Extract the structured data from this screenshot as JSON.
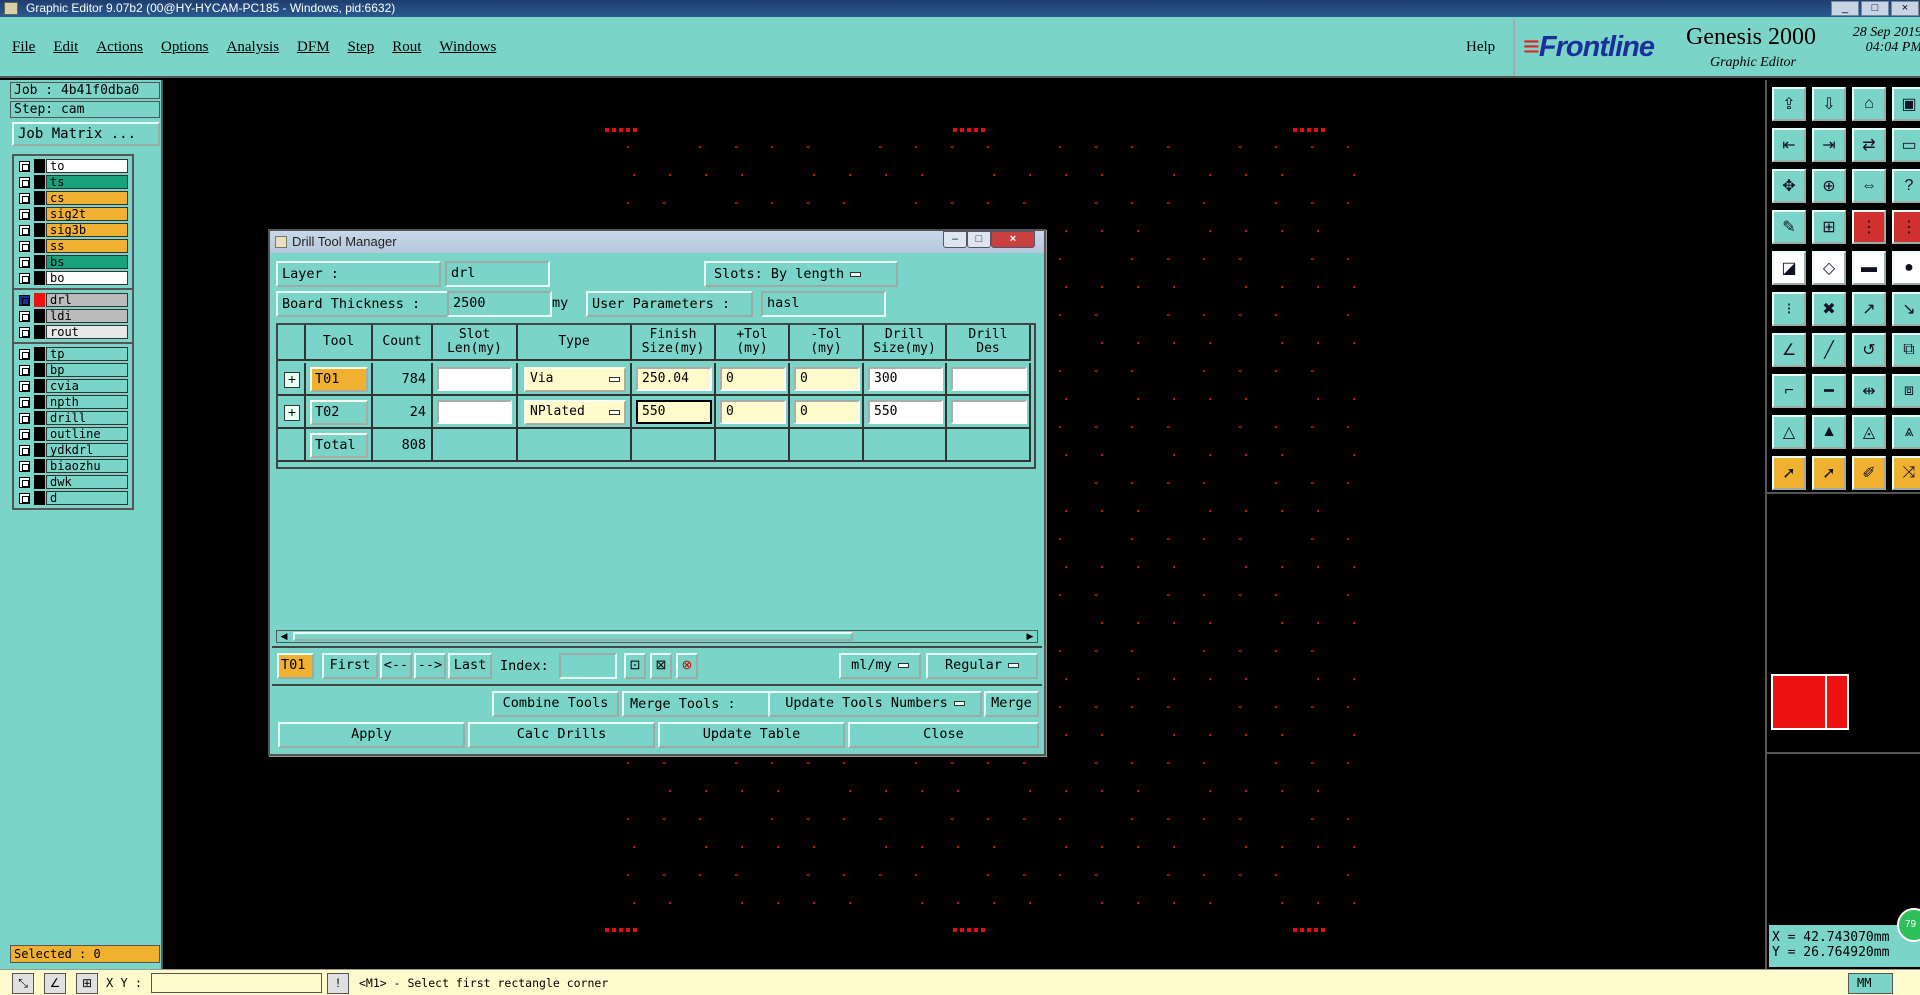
{
  "window": {
    "title": "Graphic Editor 9.07b2 (00@HY-HYCAM-PC185 - Windows, pid:6632)"
  },
  "menu": {
    "items": [
      "File",
      "Edit",
      "Actions",
      "Options",
      "Analysis",
      "DFM",
      "Step",
      "Rout",
      "Windows"
    ],
    "help": "Help"
  },
  "brand": {
    "logo": "Frontline",
    "product": "Genesis 2000",
    "subtitle": "Graphic Editor",
    "date": "28 Sep 2019",
    "time": "04:04 PM"
  },
  "left": {
    "job": "Job : 4b41f0dba0",
    "step": "Step: cam",
    "job_matrix": "Job Matrix ...",
    "board_layers": [
      {
        "name": "to",
        "color": "#ffffff"
      },
      {
        "name": "ts",
        "color": "#1aa07a"
      },
      {
        "name": "cs",
        "color": "#f0b030"
      },
      {
        "name": "sig2t",
        "color": "#f0b030"
      },
      {
        "name": "sig3b",
        "color": "#f0b030"
      },
      {
        "name": "ss",
        "color": "#f0b030"
      },
      {
        "name": "bs",
        "color": "#1aa07a"
      },
      {
        "name": "bo",
        "color": "#ffffff"
      }
    ],
    "drill_layers": [
      {
        "name": "drl",
        "color": "#bbbbbb"
      },
      {
        "name": "ldi",
        "color": "#bbbbbb"
      },
      {
        "name": "rout",
        "color": "#e8e8e8"
      }
    ],
    "misc_layers": [
      {
        "name": "tp"
      },
      {
        "name": "bp"
      },
      {
        "name": "cvia"
      },
      {
        "name": "npth"
      },
      {
        "name": "drill"
      },
      {
        "name": "outline"
      },
      {
        "name": "ydkdrl"
      },
      {
        "name": "biaozhu"
      },
      {
        "name": "dwk"
      },
      {
        "name": "d"
      }
    ],
    "selected": "Selected : 0"
  },
  "right": {
    "x": "X = 42.743070mm",
    "y": "Y = 26.764920mm",
    "badge": "79",
    "toolbar_icons": [
      "save-icon",
      "load-icon",
      "home-icon",
      "window-icon",
      "import-icon",
      "export-icon",
      "swap-icon",
      "window2-icon",
      "fit-icon",
      "center-icon",
      "ratio-icon",
      "help-icon",
      "measure-icon",
      "grid-icon",
      "snap-icon",
      "snap2-icon",
      "transform-icon",
      "shape-icon",
      "ruler-icon",
      "pad-icon",
      "net-icon",
      "cross-icon",
      "line-icon",
      "line2-icon",
      "angle-icon",
      "slash-icon",
      "arc-icon",
      "frame-icon",
      "corner-icon",
      "bar-icon",
      "resize-icon",
      "pads-icon",
      "tri-icon",
      "tri2-icon",
      "tri3-icon",
      "tri4-icon",
      "pointer-icon",
      "select-icon",
      "edit-icon",
      "route-icon"
    ]
  },
  "status": {
    "xy_label": "X Y :",
    "prompt": "<M1> - Select first rectangle corner",
    "units": "MM"
  },
  "dialog": {
    "title": "Drill Tool Manager",
    "layer_label": "Layer          :",
    "layer_value": "drl",
    "slots_label": "Slots:",
    "slots_value": "By length",
    "thickness_label": "Board Thickness :",
    "thickness_value": "2500",
    "thickness_unit": "my",
    "user_params_label": "User Parameters :",
    "user_params_value": "hasl",
    "columns": [
      {
        "l1": "Tool",
        "l2": ""
      },
      {
        "l1": "Count",
        "l2": ""
      },
      {
        "l1": "Slot",
        "l2": "Len(my)"
      },
      {
        "l1": "Type",
        "l2": ""
      },
      {
        "l1": "Finish",
        "l2": "Size(my)"
      },
      {
        "l1": "+Tol",
        "l2": "(my)"
      },
      {
        "l1": "-Tol",
        "l2": "(my)"
      },
      {
        "l1": "Drill",
        "l2": "Size(my)"
      },
      {
        "l1": "Drill",
        "l2": "Des"
      }
    ],
    "rows": [
      {
        "tool": "T01",
        "count": "784",
        "slot": "",
        "type": "Via",
        "finish": "250.04",
        "ptol": "0",
        "ntol": "0",
        "drill": "300",
        "des": ""
      },
      {
        "tool": "T02",
        "count": "24",
        "slot": "",
        "type": "NPlated",
        "finish": "550",
        "ptol": "0",
        "ntol": "0",
        "drill": "550",
        "des": ""
      }
    ],
    "total_label": "Total",
    "total_count": "808",
    "nav": {
      "current": "T01",
      "first": "First",
      "prev": "<--",
      "next": "-->",
      "last": "Last",
      "index_label": "Index:",
      "units": "ml/my",
      "mode": "Regular"
    },
    "actions": {
      "combine": "Combine Tools",
      "merge_label": "Merge Tools :",
      "merge_mode": "Update Tools Numbers",
      "merge": "Merge"
    },
    "buttons": {
      "apply": "Apply",
      "calc": "Calc Drills",
      "update": "Update Table",
      "close": "Close"
    }
  }
}
